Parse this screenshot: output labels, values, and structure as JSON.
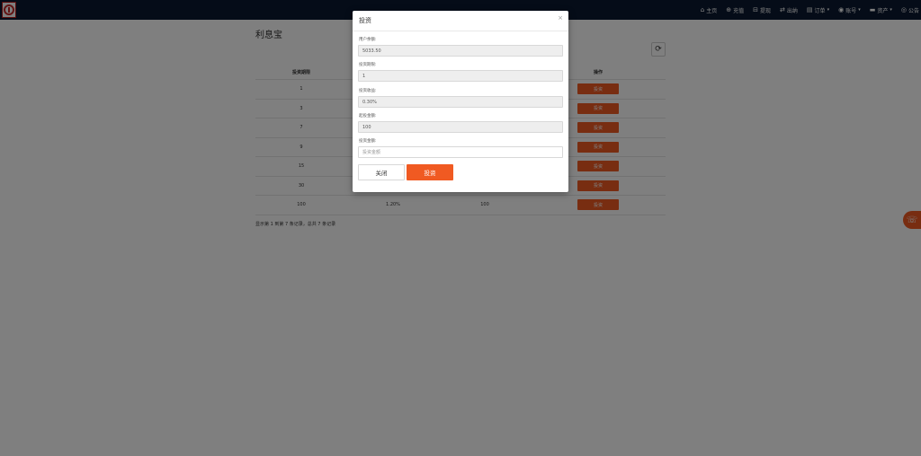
{
  "nav": {
    "items": [
      {
        "icon": "home-icon",
        "glyph": "⌂",
        "label": "主页",
        "caret": ""
      },
      {
        "icon": "recharge-icon",
        "glyph": "⊕",
        "label": "充值",
        "caret": ""
      },
      {
        "icon": "withdraw-icon",
        "glyph": "⊟",
        "label": "提现",
        "caret": ""
      },
      {
        "icon": "transfer-icon",
        "glyph": "⇄",
        "label": "出纳",
        "caret": ""
      },
      {
        "icon": "orders-icon",
        "glyph": "▤",
        "label": "订单",
        "caret": "▾"
      },
      {
        "icon": "account-icon",
        "glyph": "◉",
        "label": "账号",
        "caret": "▾"
      },
      {
        "icon": "assets-icon",
        "glyph": "▬",
        "label": "资产",
        "caret": "▾"
      },
      {
        "icon": "notice-icon",
        "glyph": "◎",
        "label": "公告",
        "caret": ""
      }
    ]
  },
  "page": {
    "title": "利息宝",
    "refresh_glyph": "⟳",
    "table": {
      "headers": [
        "投资期限",
        "",
        "",
        "操作"
      ],
      "rows": [
        {
          "c1": "1",
          "c2": "",
          "c3": "",
          "btn": "投资"
        },
        {
          "c1": "3",
          "c2": "",
          "c3": "",
          "btn": "投资"
        },
        {
          "c1": "7",
          "c2": "",
          "c3": "",
          "btn": "投资"
        },
        {
          "c1": "9",
          "c2": "",
          "c3": "",
          "btn": "投资"
        },
        {
          "c1": "15",
          "c2": "",
          "c3": "",
          "btn": "投资"
        },
        {
          "c1": "30",
          "c2": "",
          "c3": "",
          "btn": "投资"
        },
        {
          "c1": "100",
          "c2": "1.20%",
          "c3": "100",
          "btn": "投资"
        }
      ]
    },
    "footer": "显示第 1 到第 7 条记录，总共 7 条记录",
    "support_glyph": "☏"
  },
  "modal": {
    "title": "投资",
    "close_glyph": "×",
    "fields": [
      {
        "label": "用户余额:",
        "value": "5033.50"
      },
      {
        "label": "投资期限:",
        "value": "1"
      },
      {
        "label": "投资收益:",
        "value": "0.30%"
      },
      {
        "label": "起投金额:",
        "value": "100"
      }
    ],
    "amount": {
      "label": "投资金额:",
      "placeholder": "投资金额"
    },
    "buttons": {
      "close": "关闭",
      "invest": "投资"
    }
  },
  "colors": {
    "navbar": "#0b1931",
    "accent": "#f05a22"
  }
}
